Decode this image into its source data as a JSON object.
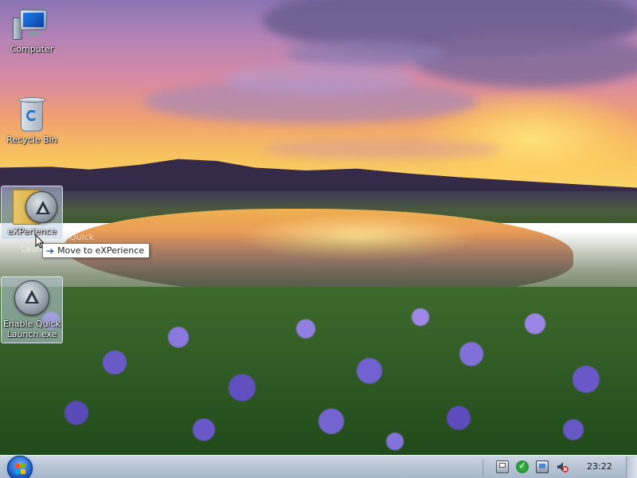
{
  "desktop": {
    "icons": [
      {
        "label": "Computer",
        "icon": "computer-icon"
      },
      {
        "label": "Recycle Bin",
        "icon": "recycle-bin-icon"
      },
      {
        "label_line1": "eXPerience",
        "icon": "experience-folder-icon",
        "selected": true
      },
      {
        "label_line1": "Enable Quick",
        "label_line2": "Launch.exe",
        "icon": "app-icon",
        "selected": true
      }
    ],
    "drag_ghost": {
      "line1": "Enable Quick",
      "line2": "Laun"
    }
  },
  "tooltip": {
    "text": "Move to eXPerience",
    "icon": "arrow-right-icon"
  },
  "taskbar": {
    "start_icon": "windows-orb-icon",
    "tray_icons": [
      "printer-icon",
      "shield-check-icon",
      "network-icon",
      "volume-muted-icon"
    ],
    "clock": "23:22"
  },
  "colors": {
    "accent": "#1a5fb4",
    "taskbar": "#b8c6d6"
  }
}
